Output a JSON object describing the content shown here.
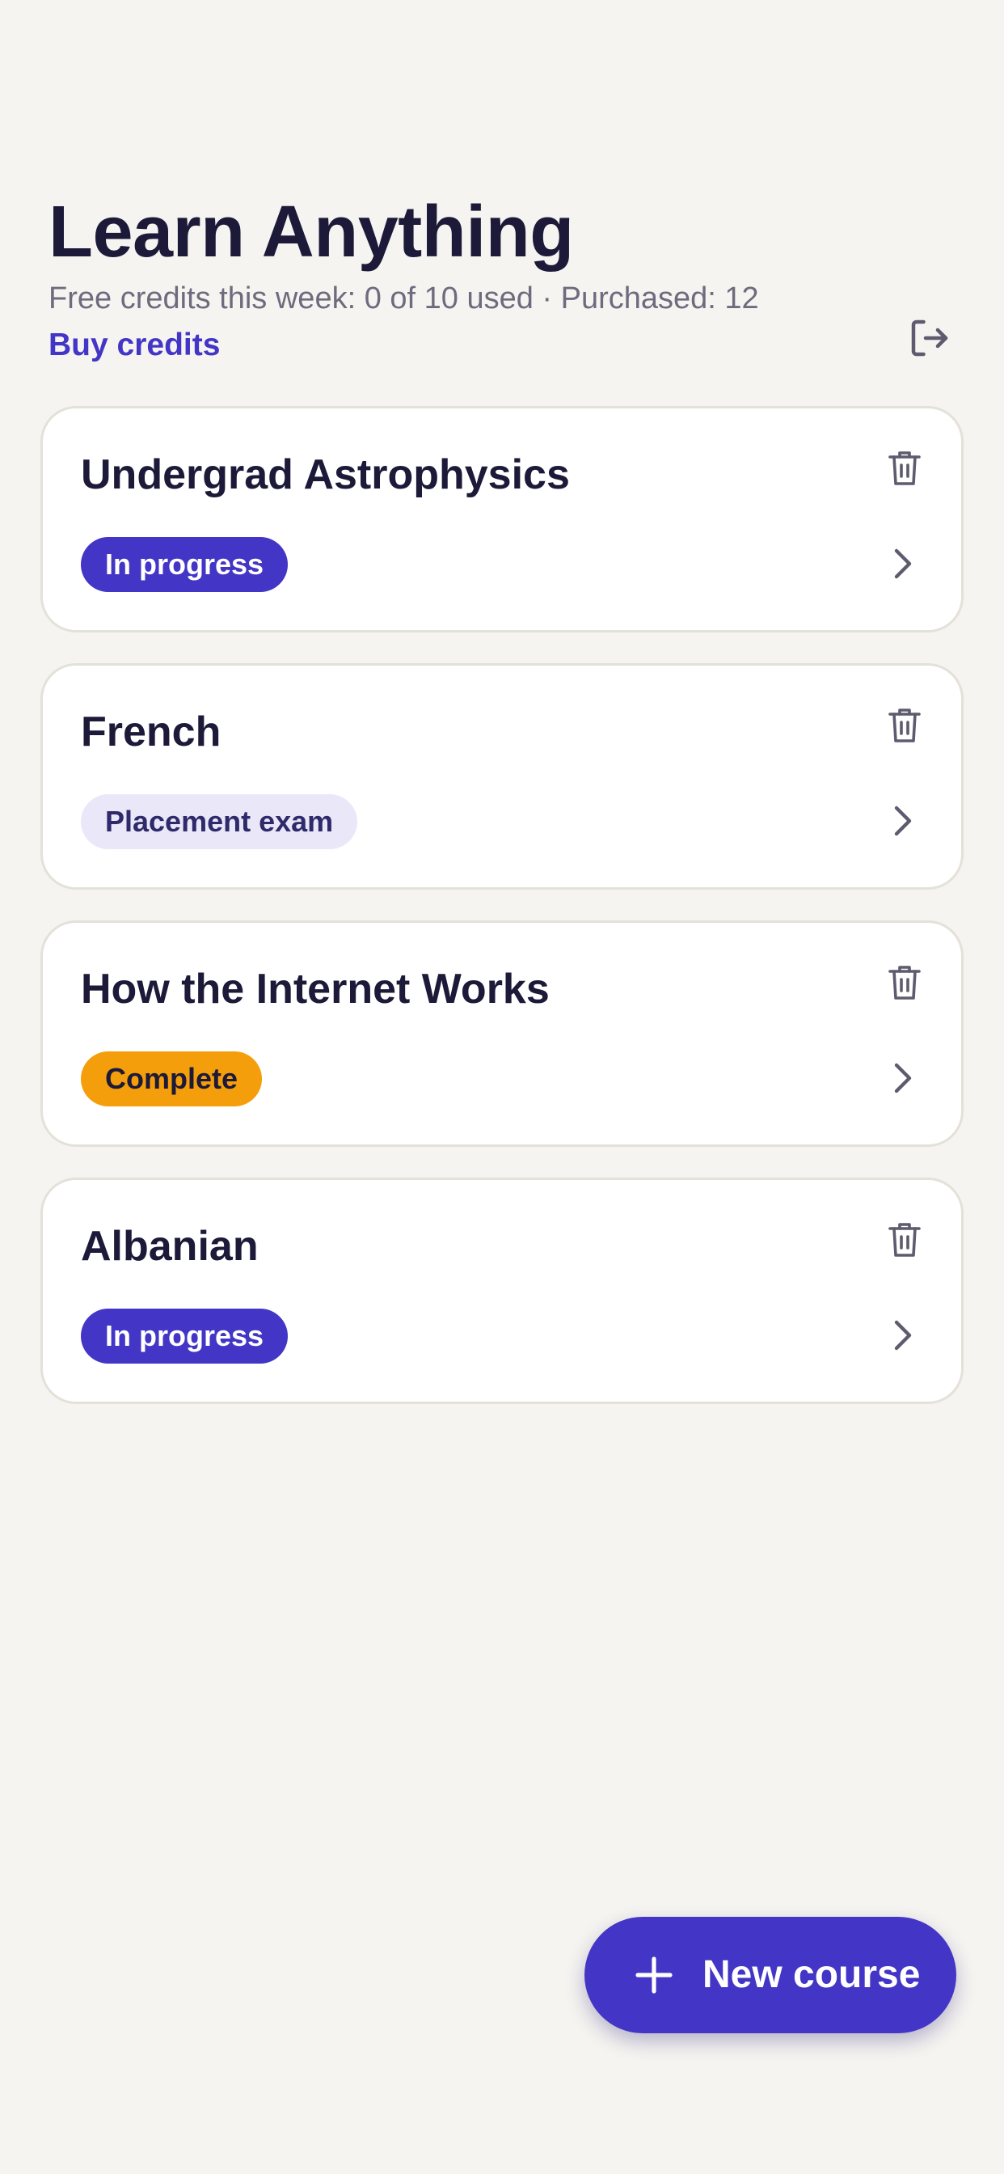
{
  "header": {
    "title": "Learn Anything",
    "credits_text": "Free credits this week: 0 of 10 used · Purchased: 12",
    "buy_credits_label": "Buy credits",
    "logout_icon": "logout-icon"
  },
  "courses": [
    {
      "title": "Undergrad Astrophysics",
      "status": "In progress",
      "status_color": "#4335C6"
    },
    {
      "title": "French",
      "status": "Placement exam",
      "status_color": "#EAE8F8"
    },
    {
      "title": "How the Internet Works",
      "status": "Complete",
      "status_color": "#F59E0B"
    },
    {
      "title": "Albanian",
      "status": "In progress",
      "status_color": "#4335C6"
    }
  ],
  "fab": {
    "label": "New course",
    "icon": "plus-icon"
  },
  "colors": {
    "accent": "#4335C6",
    "background": "#F5F4F0",
    "text": "#1C1A38",
    "muted": "#6E6B7E",
    "complete": "#F59E0B"
  }
}
